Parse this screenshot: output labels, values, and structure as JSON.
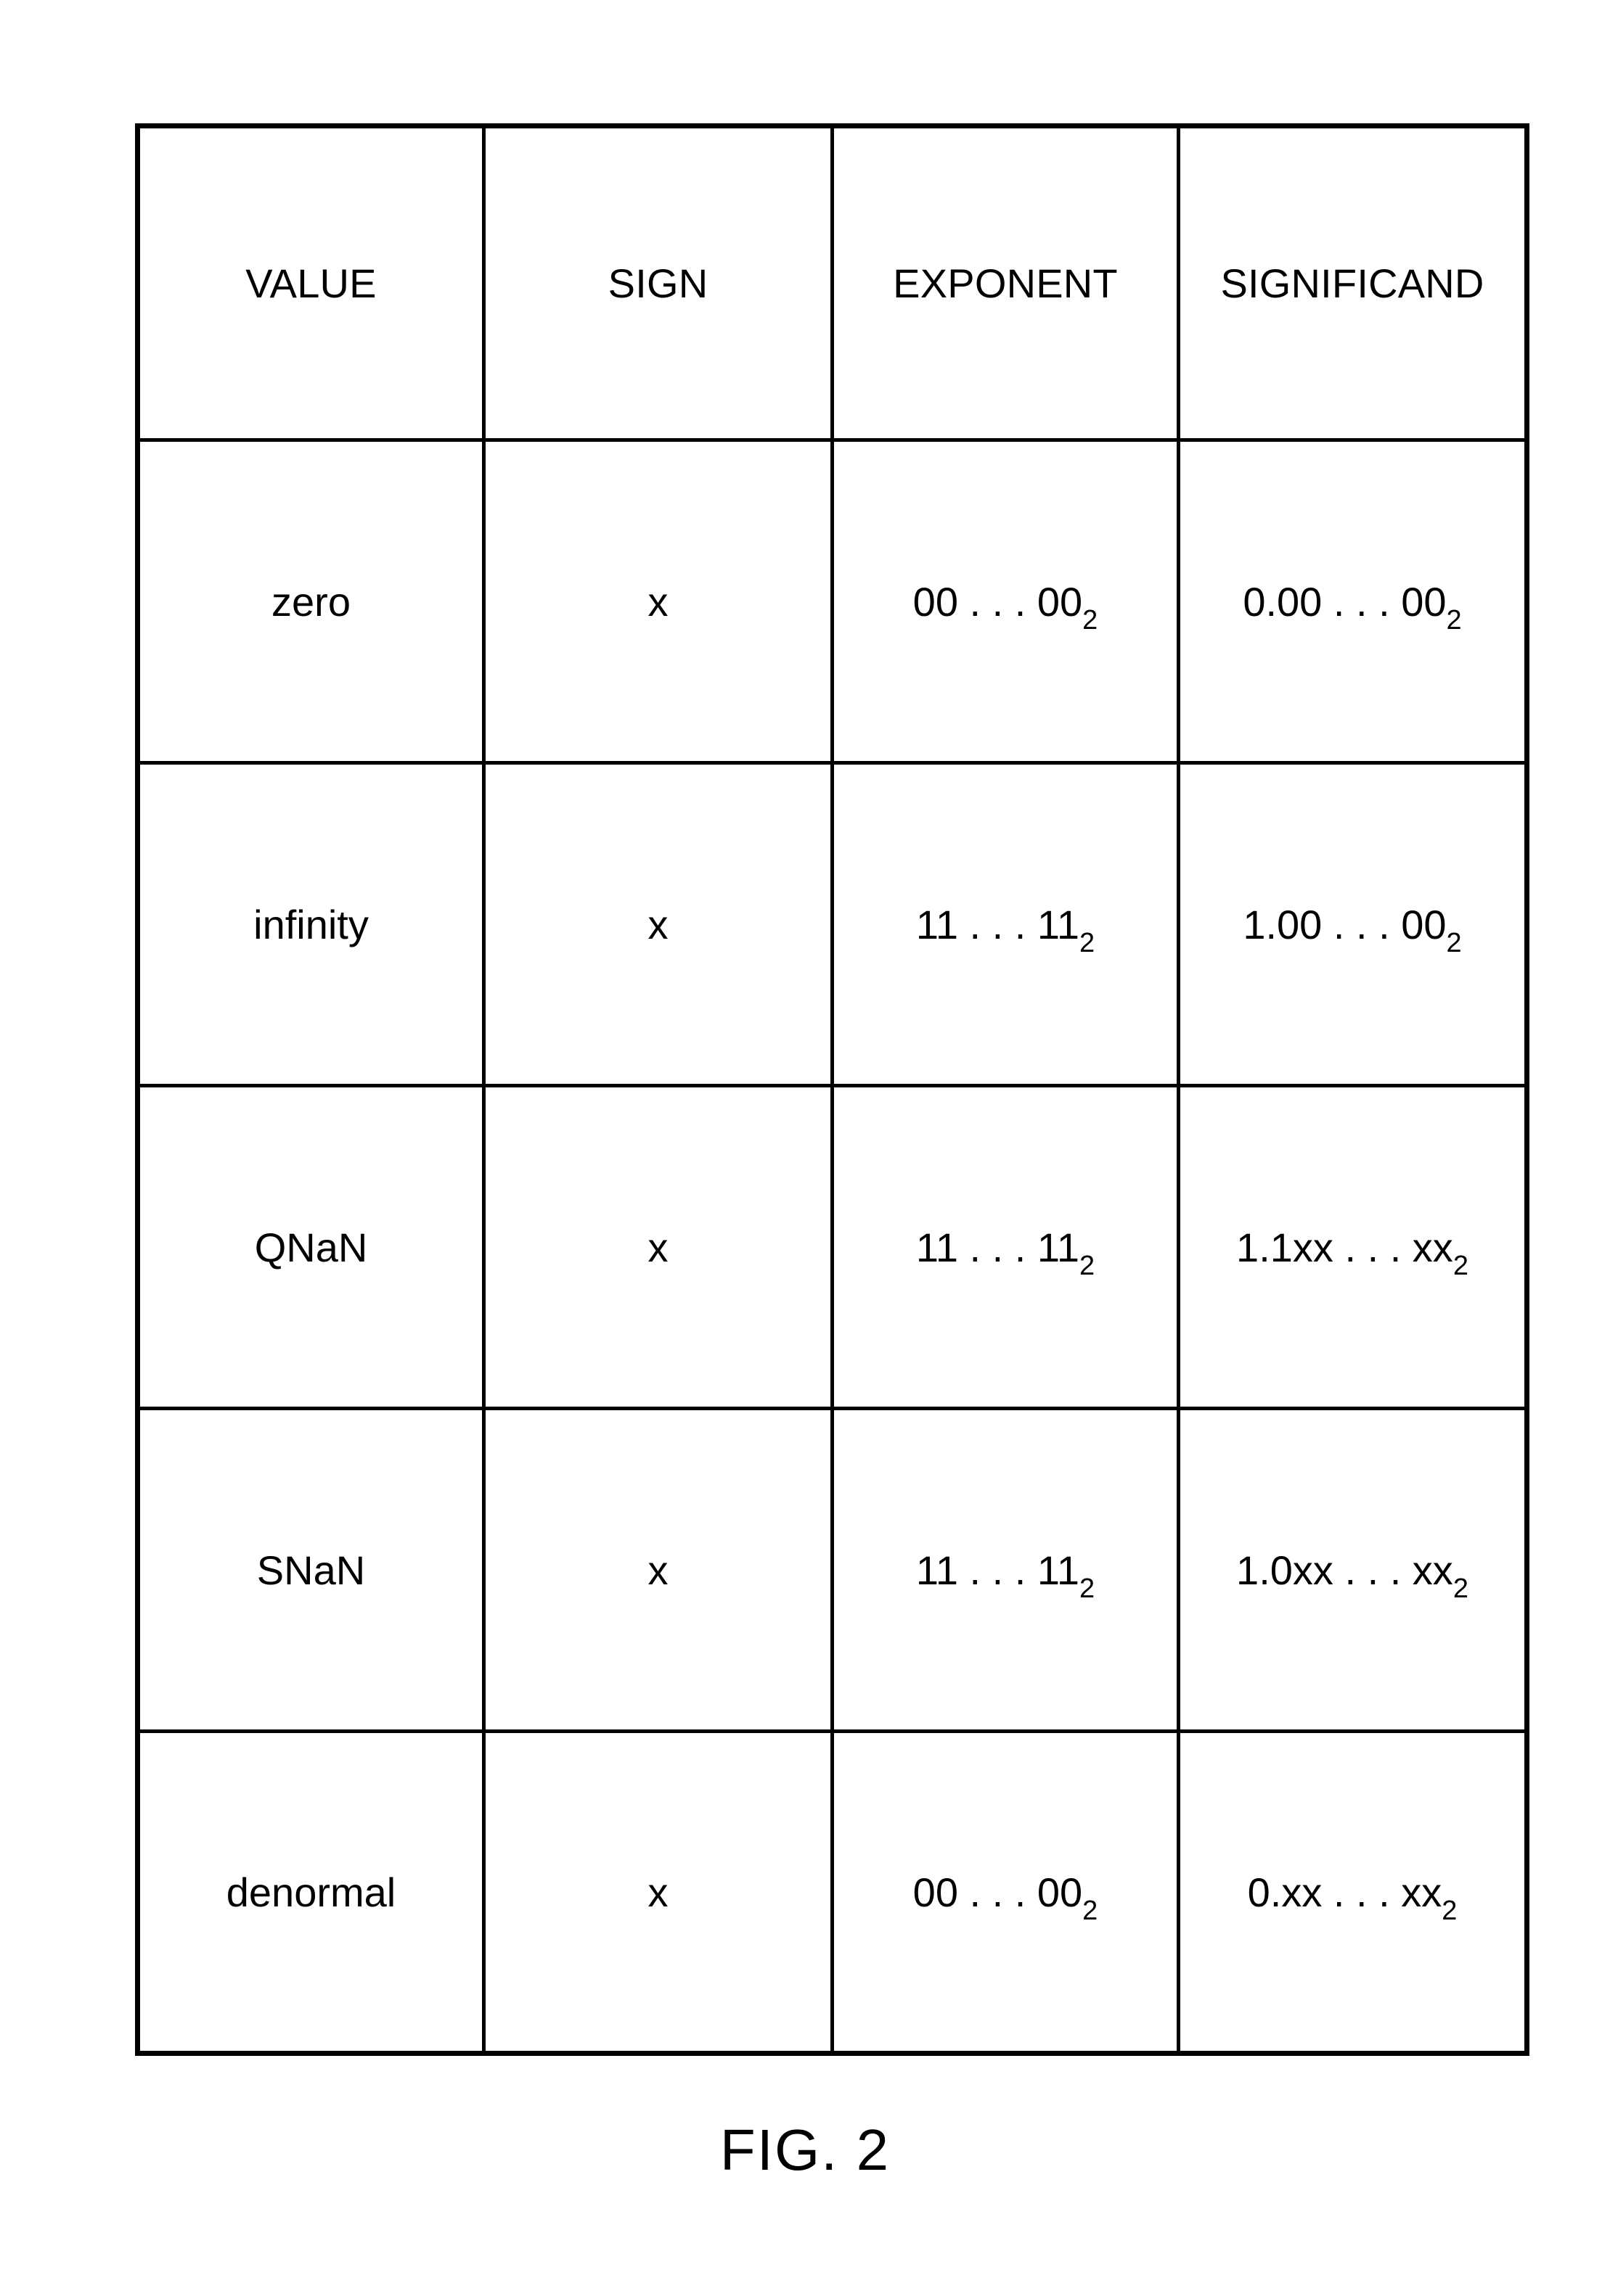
{
  "figure": {
    "caption": "FIG. 2"
  },
  "table": {
    "headers": {
      "value": "VALUE",
      "sign": "SIGN",
      "exponent": "EXPONENT",
      "significand": "SIGNIFICAND"
    },
    "rows": [
      {
        "value": "zero",
        "sign": "x",
        "exponent_mantissa": "00 . . . 00",
        "exponent_base": "2",
        "significand_mantissa": "0.00 . . . 00",
        "significand_base": "2"
      },
      {
        "value": "infinity",
        "sign": "x",
        "exponent_mantissa": "11 . . . 11",
        "exponent_base": "2",
        "significand_mantissa": "1.00 . . . 00",
        "significand_base": "2"
      },
      {
        "value": "QNaN",
        "sign": "x",
        "exponent_mantissa": "11 . . . 11",
        "exponent_base": "2",
        "significand_mantissa": "1.1xx . . . xx",
        "significand_base": "2"
      },
      {
        "value": "SNaN",
        "sign": "x",
        "exponent_mantissa": "11 . . . 11",
        "exponent_base": "2",
        "significand_mantissa": "1.0xx . . . xx",
        "significand_base": "2"
      },
      {
        "value": "denormal",
        "sign": "x",
        "exponent_mantissa": "00 . . . 00",
        "exponent_base": "2",
        "significand_mantissa": "0.xx . . . xx",
        "significand_base": "2"
      }
    ]
  }
}
